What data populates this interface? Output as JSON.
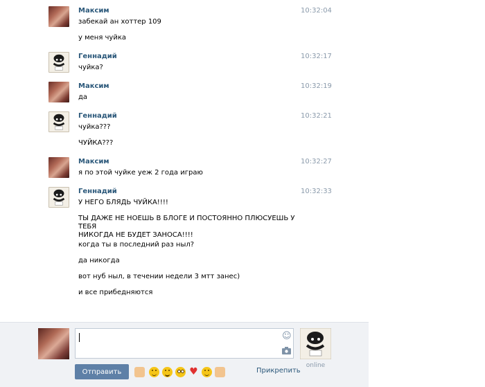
{
  "messages": [
    {
      "author": "Максим",
      "time": "10:32:04",
      "avatar": "female",
      "lines": [
        "забекай ан хоттер 109",
        "у меня чуйка"
      ]
    },
    {
      "author": "Геннадий",
      "time": "10:32:17",
      "avatar": "male",
      "lines": [
        "чуйка?"
      ]
    },
    {
      "author": "Максим",
      "time": "10:32:19",
      "avatar": "female",
      "lines": [
        "да"
      ]
    },
    {
      "author": "Геннадий",
      "time": "10:32:21",
      "avatar": "male",
      "lines": [
        "чуйка???",
        "ЧУЙКА???"
      ]
    },
    {
      "author": "Максим",
      "time": "10:32:27",
      "avatar": "female",
      "lines": [
        "я по этой чуйке уеж 2 года играю"
      ]
    },
    {
      "author": "Геннадий",
      "time": "10:32:33",
      "avatar": "male",
      "lines": [
        "У НЕГО БЛЯДЬ ЧУЙКА!!!!",
        "ТЫ ДАЖЕ НЕ НОЕШЬ В БЛОГЕ И ПОСТОЯННО ПЛЮСУЕШЬ У ТЕБЯ\nНИКОГДА НЕ БУДЕТ ЗАНОСА!!!!",
        "когда ты в последний раз ныл?",
        "да никогда",
        "вот нуб ныл, в течении недели 3 мтт занес)",
        "и все прибедняются"
      ]
    }
  ],
  "composer": {
    "input_value": "",
    "send_label": "Отправить",
    "attach_label": "Прикрепить",
    "online_label": "online",
    "emoji": [
      "thumbs-up-emoji",
      "smile-emoji",
      "grin-emoji",
      "blush-emoji",
      "heart-emoji",
      "happy-emoji",
      "muscle-emoji"
    ]
  },
  "colors": {
    "name": "#2b587a",
    "time": "#8a9aab",
    "button": "#5e80a7",
    "composer_bg": "#f0f2f5"
  }
}
